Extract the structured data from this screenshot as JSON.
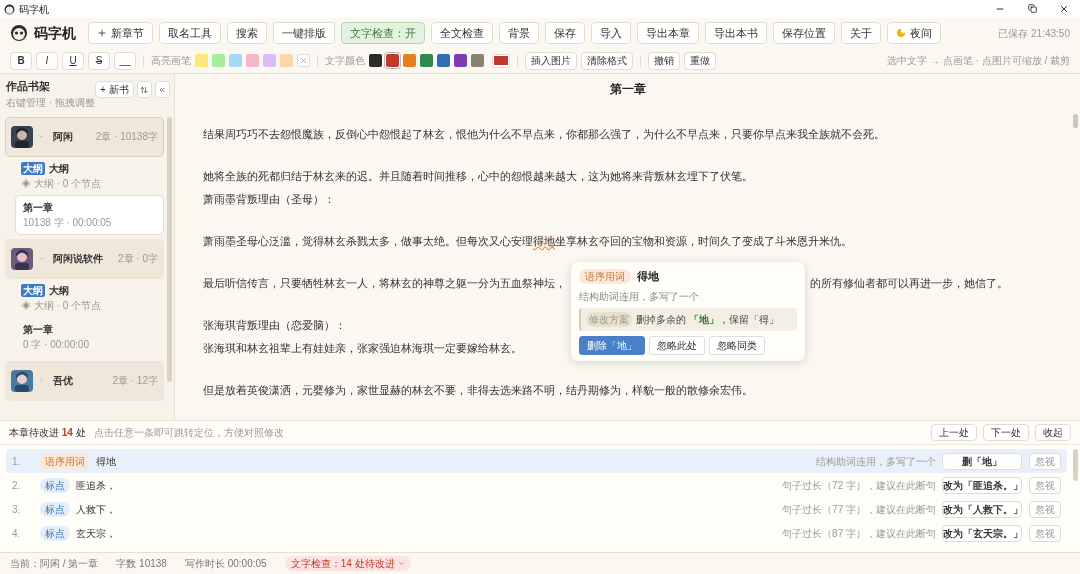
{
  "window": {
    "title": "码字机"
  },
  "app_name": "码字机",
  "toolbar": [
    {
      "label": "新章节",
      "kind": "plus"
    },
    {
      "label": "取名工具",
      "kind": "plain"
    },
    {
      "label": "搜索",
      "kind": "plain"
    },
    {
      "label": "一键排版",
      "kind": "plain"
    },
    {
      "label": "文字检查：开",
      "kind": "toggle",
      "on": true
    },
    {
      "label": "全文检查",
      "kind": "plain"
    },
    {
      "label": "背景",
      "kind": "plain"
    },
    {
      "label": "保存",
      "kind": "plain"
    },
    {
      "label": "导入",
      "kind": "plain"
    },
    {
      "label": "导出本章",
      "kind": "plain"
    },
    {
      "label": "导出本书",
      "kind": "plain"
    },
    {
      "label": "保存位置",
      "kind": "plain"
    },
    {
      "label": "关于",
      "kind": "plain"
    },
    {
      "label": "夜间",
      "kind": "moon"
    }
  ],
  "save_status": "已保存 21:43:50",
  "format_bar": {
    "style_buttons": [
      {
        "label": "B",
        "kind": "bold"
      },
      {
        "label": "I",
        "kind": "italic"
      },
      {
        "label": "U",
        "kind": "underline"
      },
      {
        "label": "S",
        "kind": "strike"
      },
      {
        "label": "__",
        "kind": "plain"
      }
    ],
    "highlight_label": "高亮画笔",
    "highlight_colors": [
      {
        "color": "#fbe77a"
      },
      {
        "color": "#a6eda0"
      },
      {
        "color": "#a8d8f8"
      },
      {
        "color": "#f8b4c8"
      },
      {
        "color": "#dcbcf8"
      },
      {
        "color": "#fcd6a8"
      }
    ],
    "text_color_label": "文字颜色",
    "text_colors": [
      {
        "color": "#2b2b2b",
        "selected": false
      },
      {
        "color": "#c0392b",
        "selected": true
      },
      {
        "color": "#e67e22",
        "selected": false
      },
      {
        "color": "#2e8b4e",
        "selected": false
      },
      {
        "color": "#2f6db5",
        "selected": false
      },
      {
        "color": "#7d3bb5",
        "selected": false
      },
      {
        "color": "#8a8272",
        "selected": false
      }
    ],
    "buttons": [
      "插入图片",
      "清除格式"
    ],
    "history_buttons": [
      "撤销",
      "重做"
    ],
    "hint": "选中文字 → 点画笔 · 点图片可缩放 / 裁剪"
  },
  "sidebar": {
    "title": "作品书架",
    "subtitle": "右键管理 · 拖拽调整",
    "new_book": "+ 新书",
    "books": [
      {
        "name": "阿闲",
        "meta": "2章 · 10138字",
        "selected": true,
        "expanded": true,
        "children": [
          {
            "kind": "outline",
            "badge": "大纲",
            "title": "大纲",
            "meta": "◈ 大纲 · 0 个节点",
            "selected": false
          },
          {
            "kind": "chapter",
            "title": "第一章",
            "meta": "10138 字 · 00:00:05",
            "selected": true
          }
        ]
      },
      {
        "name": "阿闲说软件",
        "meta": "2章 · 0字",
        "selected": false,
        "expanded": true,
        "children": [
          {
            "kind": "outline",
            "badge": "大纲",
            "title": "大纲",
            "meta": "◈ 大纲 · 0 个节点",
            "selected": false
          },
          {
            "kind": "chapter",
            "title": "第一章",
            "meta": "0 字 · 00:00:00",
            "selected": false
          }
        ]
      },
      {
        "name": "吾优",
        "meta": "2章 · 12字",
        "selected": false,
        "expanded": false
      }
    ]
  },
  "editor": {
    "title": "第一章",
    "paragraphs": [
      {
        "kind": "plain",
        "spaced": true,
        "text": "结果周巧巧不去怨恨魔族，反倒心中怨恨起了林玄，恨他为什么不早点来，你都那么强了，为什么不早点来，只要你早点来我全族就不会死。"
      },
      {
        "kind": "plain",
        "spaced": true,
        "text": "她将全族的死都归结于林玄来的迟。并且随着时间推移，心中的怨恨越来越大，这为她将来背叛林玄埋下了伏笔。"
      },
      {
        "kind": "plain",
        "spaced": false,
        "text": "萧雨墨背叛理由（圣母）："
      },
      {
        "kind": "flagged",
        "spaced": true,
        "before": "萧雨墨圣母心泛滥，觉得林玄杀戮太多，做事太绝。但每次又心安理",
        "flagged": "得地",
        "after": "坐享林玄夺回的宝物和资源，时间久了变成了斗米恩升米仇。"
      },
      {
        "kind": "covered",
        "spaced": true,
        "before": "最后听信传言，只要牺牲林玄一人，将林玄的神尊之躯一分为五血祭神坛，",
        "after": "的所有修仙者都可以再进一步，她信了。"
      },
      {
        "kind": "plain",
        "spaced": true,
        "text": "张海琪背叛理由（恋爱脑）："
      },
      {
        "kind": "plain",
        "spaced": false,
        "text": "张海琪和林玄祖辈上有娃娃亲，张家强迫林海琪一定要嫁给林玄。"
      },
      {
        "kind": "plain",
        "spaced": true,
        "text": "但是放着英俊潇洒，元婴修为，家世显赫的林玄不要，非得去选来路不明，结丹期修为，样貌一般的散修余宏伟。"
      }
    ]
  },
  "popup": {
    "tag": "语序用词",
    "word": "得地",
    "description": "结构助词连用，多写了一个",
    "fix_label": "修改方案",
    "fix_text": "删掉多余的 **「地」**，保留「得」",
    "buttons": [
      {
        "label": "删除「地」",
        "kind": "primary"
      },
      {
        "label": "忽略此处",
        "kind": "plain"
      },
      {
        "label": "忽略同类",
        "kind": "plain"
      }
    ]
  },
  "issues": {
    "summary": "本章待改进 **14** 处",
    "hint": "点击任意一条即可跳转定位，方便对照修改",
    "nav_buttons": [
      "上一处",
      "下一处",
      "收起"
    ],
    "rows": [
      {
        "number": "1.",
        "tag": "语序用词",
        "kind": "wording",
        "text": "得地",
        "note": "结构助词连用，多写了一个",
        "fix": "删「地」",
        "ignore": "忽视",
        "selected": true
      },
      {
        "number": "2.",
        "tag": "标点",
        "kind": "punctuation",
        "text": "匪追杀，",
        "note": "句子过长（72 字），建议在此断句",
        "fix": "改为「匪追杀。」",
        "ignore": "忽视",
        "selected": false
      },
      {
        "number": "3.",
        "tag": "标点",
        "kind": "punctuation",
        "text": "人救下，",
        "note": "句子过长（77 字），建议在此断句",
        "fix": "改为「人救下。」",
        "ignore": "忽视",
        "selected": false
      },
      {
        "number": "4.",
        "tag": "标点",
        "kind": "punctuation",
        "text": "玄天宗，",
        "note": "句子过长（87 字），建议在此断句",
        "fix": "改为「玄天宗。」",
        "ignore": "忽视",
        "selected": false
      }
    ]
  },
  "status_bar": {
    "current": "当前：阿闲 / 第一章",
    "word_count": "字数 10138",
    "duration": "写作时长 00:00:05",
    "check": "文字检查：14 处待改进"
  }
}
